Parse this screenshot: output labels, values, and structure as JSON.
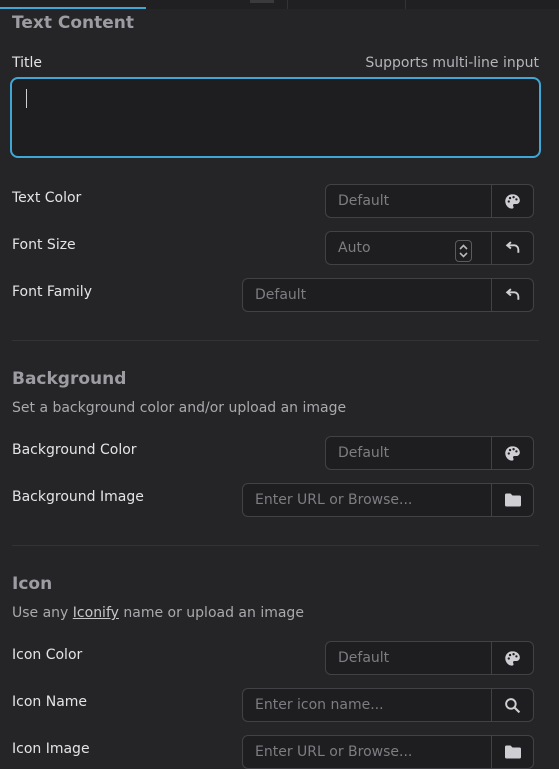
{
  "text_content": {
    "heading": "Text Content",
    "title_label": "Title",
    "title_hint": "Supports multi-line input",
    "title_value": "",
    "text_color": {
      "label": "Text Color",
      "placeholder": "Default",
      "button_icon": "palette-icon"
    },
    "font_size": {
      "label": "Font Size",
      "placeholder": "Auto",
      "button_icon": "reset-icon"
    },
    "font_family": {
      "label": "Font Family",
      "placeholder": "Default",
      "button_icon": "reset-icon"
    }
  },
  "background": {
    "heading": "Background",
    "description": "Set a background color and/or upload an image",
    "color": {
      "label": "Background Color",
      "placeholder": "Default",
      "button_icon": "palette-icon"
    },
    "image": {
      "label": "Background Image",
      "placeholder": "Enter URL or Browse...",
      "button_icon": "folder-icon"
    }
  },
  "icon": {
    "heading": "Icon",
    "description_before": "Use any ",
    "description_link": "Iconify",
    "description_after": " name or upload an image",
    "color": {
      "label": "Icon Color",
      "placeholder": "Default",
      "button_icon": "palette-icon"
    },
    "name": {
      "label": "Icon Name",
      "placeholder": "Enter icon name...",
      "button_icon": "search-icon"
    },
    "image": {
      "label": "Icon Image",
      "placeholder": "Enter URL or Browse...",
      "button_icon": "folder-icon"
    }
  },
  "colors": {
    "accent": "#3fa7d6",
    "background": "#252527",
    "input_bg": "#1e1e20"
  }
}
